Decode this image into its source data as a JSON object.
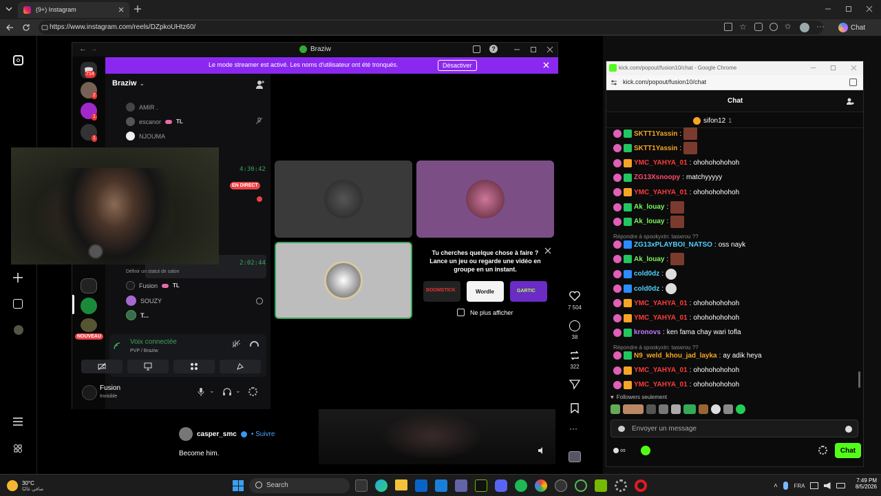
{
  "browser": {
    "tab_title": "(9+) Instagram",
    "url": "https://www.instagram.com/reels/DZpkoUHtz60/",
    "copilot_label": "Chat"
  },
  "instagram": {
    "reel": {
      "likes": "7 504",
      "comments": "38",
      "reposts": "322",
      "author": "casper_smc",
      "follow_label": "• Suivre",
      "caption": "Become him."
    }
  },
  "discord": {
    "window_title": "Braziw",
    "banner_text": "Le mode streamer est activé. Les noms d'utilisateur ont été tronqués.",
    "banner_button": "Désactiver",
    "server_badges": [
      "714",
      "2",
      "1",
      "1"
    ],
    "server_name": "Braziw",
    "channel_members": [
      {
        "name": "AMIR ."
      },
      {
        "name": "escanor",
        "tag": "TL"
      },
      {
        "name": "NJOUMA"
      }
    ],
    "live_time_1": "4:30:42",
    "live_label": "EN DIRECT",
    "live_time_2": "2:02:44",
    "set_status": "Définir un statut de salon",
    "voice_members": [
      {
        "name": "Fusion",
        "tag": "TL"
      },
      {
        "name": "SOUZY"
      },
      {
        "name": "T..."
      }
    ],
    "new_label": "NOUVEAU",
    "voice_connected": "Voix connectée",
    "voice_channel": "PVP / Braziw",
    "user_name": "Fusion",
    "user_status": "Invisible",
    "activity_prompt": "Tu cherches quelque chose à faire ? Lance un jeu ou regarde une vidéo en groupe en un instant.",
    "activity_games": [
      "BOOMSTICK",
      "Wordle",
      "GARTIC"
    ],
    "dont_show": "Ne plus afficher"
  },
  "kick": {
    "window_title": "kick.com/popout/fusion10/chat - Google Chrome",
    "url": "kick.com/popout/fusion10/chat",
    "header": "Chat",
    "pinned_user": "sifon12",
    "pinned_count": "1",
    "messages": [
      {
        "user": "SKTT1Yassin",
        "color": "#f5a623",
        "text": "",
        "emote": true
      },
      {
        "user": "SKTT1Yassin",
        "color": "#f5a623",
        "text": "",
        "emote": true
      },
      {
        "user": "YMC_YAHYA_01",
        "color": "#ff3b3b",
        "text": "ohohohohohoh"
      },
      {
        "user": "ZG13Xsnoopy",
        "color": "#ff4b6e",
        "text": "matchyyyyy"
      },
      {
        "user": "YMC_YAHYA_01",
        "color": "#ff3b3b",
        "text": "ohohohohohoh"
      },
      {
        "user": "Ak_louay",
        "color": "#7cf55a",
        "text": "",
        "emote": true
      },
      {
        "user": "Ak_louay",
        "color": "#7cf55a",
        "text": "",
        "emote": true
      },
      {
        "reply": "Répondre à spookyxtn: taswrou ??",
        "user": "ZG13xPLAYBOI_NATSO",
        "color": "#4fd1ff",
        "text": "oss nayk"
      },
      {
        "user": "Ak_louay",
        "color": "#7cf55a",
        "text": "",
        "emote": true
      },
      {
        "user": "cold0dz",
        "color": "#4fd1ff",
        "text": "",
        "emote": true
      },
      {
        "user": "cold0dz",
        "color": "#4fd1ff",
        "text": "",
        "emote": true
      },
      {
        "user": "YMC_YAHYA_01",
        "color": "#ff3b3b",
        "text": "ohohohohohoh"
      },
      {
        "user": "YMC_YAHYA_01",
        "color": "#ff3b3b",
        "text": "ohohohohohoh"
      },
      {
        "user": "kronovs",
        "color": "#c27bff",
        "text": "ken fama chay wari tofla"
      },
      {
        "reply": "Répondre à spookyxtn: taswrou ??",
        "user": "N9_weld_khou_jad_layka",
        "color": "#f5a623",
        "text": "ay adik heya"
      },
      {
        "user": "YMC_YAHYA_01",
        "color": "#ff3b3b",
        "text": "ohohohohohoh"
      },
      {
        "user": "YMC_YAHYA_01",
        "color": "#ff3b3b",
        "text": "ohohohohohoh"
      }
    ],
    "followers_only": "Followers seulement",
    "input_placeholder": "Envoyer un message",
    "send_label": "Chat"
  },
  "taskbar": {
    "weather_temp": "30°C",
    "weather_desc": "صافي غالبًا",
    "search_placeholder": "Search",
    "lang": "FRA",
    "time": "7:49 PM",
    "date": "8/5/2026"
  },
  "colors": {
    "discord_purple": "#8b28ef",
    "kick_green": "#53fc18",
    "live_red": "#ed4245"
  }
}
